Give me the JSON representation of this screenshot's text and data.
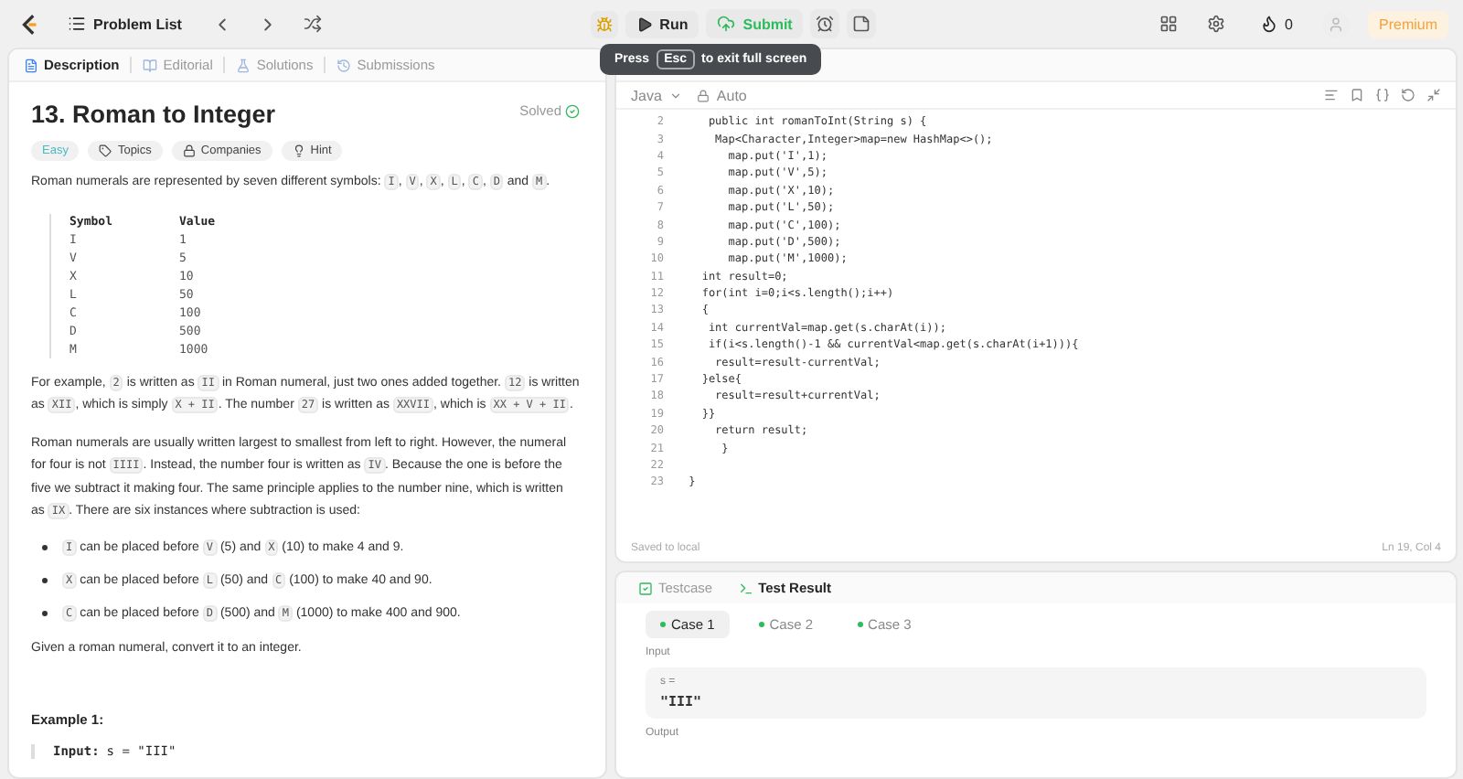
{
  "topbar": {
    "problem_list": "Problem List",
    "run": "Run",
    "submit": "Submit",
    "streak": "0",
    "premium": "Premium"
  },
  "fullscreen_tip": {
    "before": "Press",
    "key": "Esc",
    "after": "to exit full screen"
  },
  "tabs": [
    {
      "label": "Description",
      "selected": true
    },
    {
      "label": "Editorial",
      "selected": false
    },
    {
      "label": "Solutions",
      "selected": false
    },
    {
      "label": "Submissions",
      "selected": false
    }
  ],
  "problem": {
    "title": "13. Roman to Integer",
    "status": "Solved",
    "difficulty": "Easy",
    "tags": [
      "Topics",
      "Companies",
      "Hint"
    ],
    "intro": [
      {
        "t": "Roman numerals are represented by seven different symbols: ",
        "code": false
      },
      {
        "t": "I",
        "code": true
      },
      {
        "t": ", ",
        "code": false
      },
      {
        "t": "V",
        "code": true
      },
      {
        "t": ", ",
        "code": false
      },
      {
        "t": "X",
        "code": true
      },
      {
        "t": ", ",
        "code": false
      },
      {
        "t": "L",
        "code": true
      },
      {
        "t": ", ",
        "code": false
      },
      {
        "t": "C",
        "code": true
      },
      {
        "t": ", ",
        "code": false
      },
      {
        "t": "D",
        "code": true
      },
      {
        "t": " and ",
        "code": false
      },
      {
        "t": "M",
        "code": true
      },
      {
        "t": ".",
        "code": false
      }
    ],
    "table": {
      "columns": [
        "Symbol",
        "Value"
      ],
      "rows": [
        [
          "I",
          "1"
        ],
        [
          "V",
          "5"
        ],
        [
          "X",
          "10"
        ],
        [
          "L",
          "50"
        ],
        [
          "C",
          "100"
        ],
        [
          "D",
          "500"
        ],
        [
          "M",
          "1000"
        ]
      ]
    },
    "paragraphs": [
      [
        {
          "t": "For example, ",
          "code": false
        },
        {
          "t": "2",
          "code": true
        },
        {
          "t": " is written as ",
          "code": false
        },
        {
          "t": "II",
          "code": true
        },
        {
          "t": " in Roman numeral, just two ones added together. ",
          "code": false
        },
        {
          "t": "12",
          "code": true
        },
        {
          "t": " is written as ",
          "code": false
        },
        {
          "t": "XII",
          "code": true
        },
        {
          "t": ", which is simply ",
          "code": false
        },
        {
          "t": "X + II",
          "code": true
        },
        {
          "t": ". The number ",
          "code": false
        },
        {
          "t": "27",
          "code": true
        },
        {
          "t": " is written as ",
          "code": false
        },
        {
          "t": "XXVII",
          "code": true
        },
        {
          "t": ", which is ",
          "code": false
        },
        {
          "t": "XX + V + II",
          "code": true
        },
        {
          "t": ".",
          "code": false
        }
      ],
      [
        {
          "t": "Roman numerals are usually written largest to smallest from left to right. However, the numeral for four is not ",
          "code": false
        },
        {
          "t": "IIII",
          "code": true
        },
        {
          "t": ". Instead, the number four is written as ",
          "code": false
        },
        {
          "t": "IV",
          "code": true
        },
        {
          "t": ". Because the one is before the five we subtract it making four. The same principle applies to the number nine, which is written as ",
          "code": false
        },
        {
          "t": "IX",
          "code": true
        },
        {
          "t": ". There are six instances where subtraction is used:",
          "code": false
        }
      ]
    ],
    "bullets": [
      [
        {
          "t": "I",
          "code": true
        },
        {
          "t": " can be placed before ",
          "code": false
        },
        {
          "t": "V",
          "code": true
        },
        {
          "t": " (5) and ",
          "code": false
        },
        {
          "t": "X",
          "code": true
        },
        {
          "t": " (10) to make 4 and 9.",
          "code": false
        }
      ],
      [
        {
          "t": "X",
          "code": true
        },
        {
          "t": " can be placed before ",
          "code": false
        },
        {
          "t": "L",
          "code": true
        },
        {
          "t": " (50) and ",
          "code": false
        },
        {
          "t": "C",
          "code": true
        },
        {
          "t": " (100) to make 40 and 90.",
          "code": false
        }
      ],
      [
        {
          "t": "C",
          "code": true
        },
        {
          "t": " can be placed before ",
          "code": false
        },
        {
          "t": "D",
          "code": true
        },
        {
          "t": " (500) and ",
          "code": false
        },
        {
          "t": "M",
          "code": true
        },
        {
          "t": " (1000) to make 400 and 900.",
          "code": false
        }
      ]
    ],
    "task": "Given a roman numeral, convert it to an integer.",
    "example_title": "Example 1:",
    "example_label": "Input:",
    "example_value": "s = \"III\""
  },
  "editor": {
    "language": "Java",
    "mode": "Auto",
    "lines": [
      {
        "number": "2",
        "code": "    public int romanToInt(String s) {"
      },
      {
        "number": "3",
        "code": "     Map<Character,Integer>map=new HashMap<>();"
      },
      {
        "number": "4",
        "code": "       map.put('I',1);"
      },
      {
        "number": "5",
        "code": "       map.put('V',5);"
      },
      {
        "number": "6",
        "code": "       map.put('X',10);"
      },
      {
        "number": "7",
        "code": "       map.put('L',50);"
      },
      {
        "number": "8",
        "code": "       map.put('C',100);"
      },
      {
        "number": "9",
        "code": "       map.put('D',500);"
      },
      {
        "number": "10",
        "code": "       map.put('M',1000);"
      },
      {
        "number": "11",
        "code": "   int result=0;"
      },
      {
        "number": "12",
        "code": "   for(int i=0;i<s.length();i++)"
      },
      {
        "number": "13",
        "code": "   {"
      },
      {
        "number": "14",
        "code": "    int currentVal=map.get(s.charAt(i));"
      },
      {
        "number": "15",
        "code": "    if(i<s.length()-1 && currentVal<map.get(s.charAt(i+1))){"
      },
      {
        "number": "16",
        "code": "     result=result-currentVal;"
      },
      {
        "number": "17",
        "code": "   }else{"
      },
      {
        "number": "18",
        "code": "     result=result+currentVal;"
      },
      {
        "number": "19",
        "code": "   }}"
      },
      {
        "number": "20",
        "code": "     return result;"
      },
      {
        "number": "21",
        "code": "      }"
      },
      {
        "number": "22"
      },
      {
        "number": "23",
        "code": " }"
      }
    ],
    "saved": "Saved to local",
    "cursor": "Ln 19, Col 4"
  },
  "test_tabs": [
    {
      "label": "Testcase",
      "selected": false
    },
    {
      "label": "Test Result",
      "selected": true
    }
  ],
  "cases": [
    {
      "label": "Case 1",
      "selected": true
    },
    {
      "label": "Case 2",
      "selected": false
    },
    {
      "label": "Case 3",
      "selected": false
    }
  ],
  "input": {
    "label": "Input",
    "var": "s =",
    "value": "\"III\""
  },
  "output": {
    "label": "Output"
  }
}
